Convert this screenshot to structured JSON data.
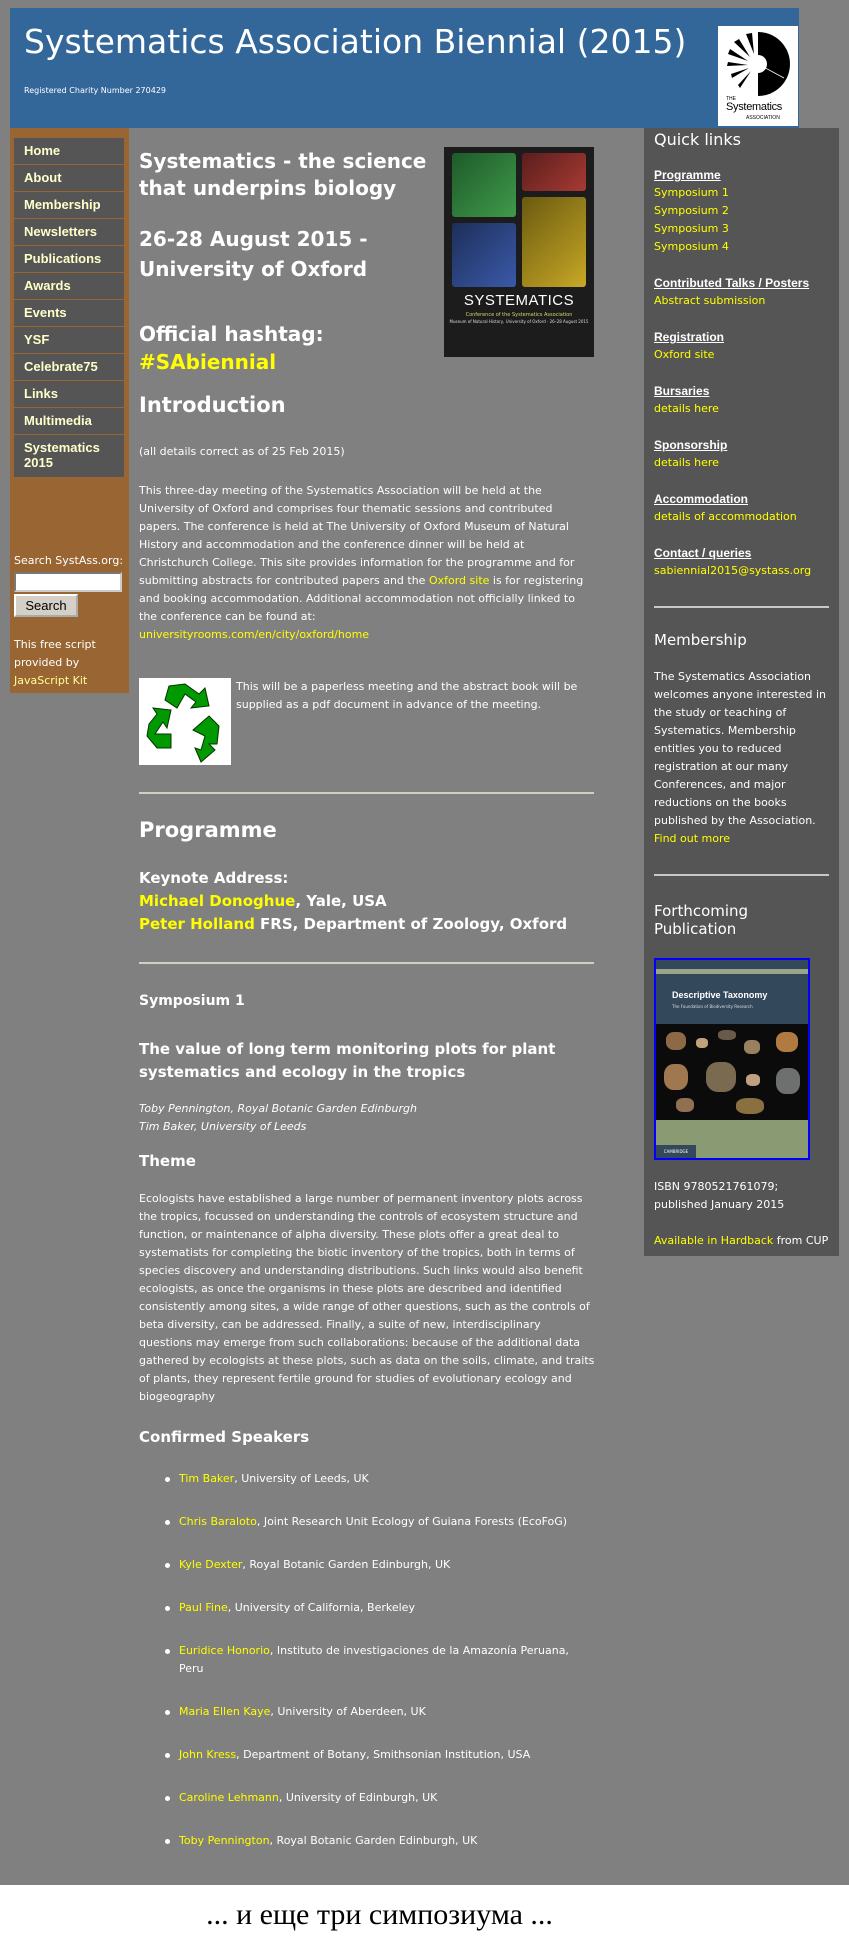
{
  "header": {
    "title": "Systematics Association Biennial (2015)",
    "charity": "Registered Charity Number 270429",
    "logo": {
      "icon": "systematics-association-logo",
      "line1": "THE",
      "line2": "Systematics",
      "line3": "ASSOCIATION"
    }
  },
  "colors": {
    "page_bg": "#808080",
    "header_bg": "#336699",
    "left_nav_bg": "#996633",
    "nav_item_bg": "#555555",
    "nav_text": "#ffffcc",
    "right_bar_bg": "#555555",
    "link": "#ffff00"
  },
  "nav": {
    "items": [
      {
        "label": "Home"
      },
      {
        "label": "About"
      },
      {
        "label": "Membership"
      },
      {
        "label": "Newsletters"
      },
      {
        "label": "Publications"
      },
      {
        "label": "Awards"
      },
      {
        "label": "Events"
      },
      {
        "label": "YSF"
      },
      {
        "label": "Celebrate75"
      },
      {
        "label": "Links"
      },
      {
        "label": "Multimedia"
      },
      {
        "label": "Systematics 2015"
      }
    ],
    "search_label": "Search SystAss.org:",
    "search_value": "",
    "search_button": "Search",
    "free_script_line1": "This free script",
    "free_script_line2": "provided by",
    "free_script_link": "JavaScript Kit"
  },
  "main": {
    "tagline": "Systematics - the science that underpins biology",
    "dates": "26-28 August 2015 - University of Oxford",
    "hashtag_label": "Official hashtag:",
    "hashtag": "#SAbiennial",
    "poster": {
      "title": "SYSTEMATICS",
      "subtitle": "Conference of the Systematics Association",
      "details": "Museum of Natural History, University of Oxford · 26–28 August 2015"
    },
    "intro_heading": "Introduction",
    "as_of": "(all details correct as of 25 Feb 2015)",
    "intro_text_1": "This three-day meeting of the Systematics Association will be held at the University of Oxford and comprises four thematic sessions and contributed papers. The conference is held at The University of Oxford Museum of Natural History and accommodation and the conference dinner will be held at Christchurch College. This site provides information for the programme and for submitting abstracts for contributed papers and the ",
    "intro_link_oxford": "Oxford site",
    "intro_text_2": " is for registering and booking accommodation. Additional accommodation not officially linked to the conference can be found at:",
    "intro_link_rooms": "universityrooms.com/en/city/oxford/home",
    "paperless": "This will be a paperless meeting and the abstract book will be supplied as a pdf document in advance of the meeting.",
    "programme_heading": "Programme",
    "keynote_label": "Keynote Address:",
    "keynotes": [
      {
        "name": "Michael Donoghue",
        "affiliation": ", Yale, USA"
      },
      {
        "name": "Peter Holland",
        "affiliation": " FRS, Department of Zoology, Oxford"
      }
    ],
    "symposium_label": "Symposium 1",
    "symposium_title": "The value of long term monitoring plots for plant systematics and ecology in the tropics",
    "organisers": [
      "Toby Pennington, Royal Botanic Garden Edinburgh",
      "Tim Baker, University of Leeds"
    ],
    "theme_heading": "Theme",
    "theme_text": "Ecologists have established a large number of permanent inventory plots across the tropics, focussed on understanding the controls of ecosystem structure and function, or maintenance of alpha diversity. These plots offer a great deal to systematists for completing the biotic inventory of the tropics, both in terms of species discovery and understanding distributions. Such links would also benefit ecologists, as once the organisms in these plots are described and identified consistently among sites, a wide range of other questions, such as the controls of beta diversity, can be addressed. Finally, a suite of new, interdisciplinary questions may emerge from such collaborations: because of the additional data gathered by ecologists at these plots, such as data on the soils, climate, and traits of plants, they represent fertile ground for studies of evolutionary ecology and biogeography",
    "speakers_heading": "Confirmed Speakers",
    "speakers": [
      {
        "name": "Tim Baker",
        "affiliation": ", University of Leeds, UK"
      },
      {
        "name": "Chris Baraloto",
        "affiliation": ", Joint Research Unit Ecology of Guiana Forests (EcoFoG)"
      },
      {
        "name": "Kyle Dexter",
        "affiliation": ", Royal Botanic Garden Edinburgh, UK"
      },
      {
        "name": "Paul Fine",
        "affiliation": ", University of California, Berkeley"
      },
      {
        "name": "Euridice Honorio",
        "affiliation": ", Instituto de investigaciones de la Amazonía Peruana, Peru"
      },
      {
        "name": "Maria Ellen Kaye",
        "affiliation": ", University of Aberdeen, UK"
      },
      {
        "name": "John Kress",
        "affiliation": ", Department of Botany, Smithsonian Institution, USA"
      },
      {
        "name": "Caroline Lehmann",
        "affiliation": ", University of Edinburgh, UK"
      },
      {
        "name": "Toby Pennington",
        "affiliation": ", Royal Botanic Garden Edinburgh, UK"
      }
    ]
  },
  "sidebar": {
    "quick_links_heading": "Quick links",
    "groups": [
      {
        "category": "Programme",
        "links": [
          "Symposium 1",
          "Symposium 2",
          "Symposium 3",
          "Symposium 4"
        ]
      },
      {
        "category": "Contributed Talks / Posters",
        "links": [
          "Abstract submission"
        ]
      },
      {
        "category": "Registration",
        "links": [
          "Oxford site"
        ]
      },
      {
        "category": "Bursaries",
        "links": [
          "details here"
        ]
      },
      {
        "category": "Sponsorship",
        "links": [
          "details here"
        ]
      },
      {
        "category": "Accommodation",
        "links": [
          "details of accommodation"
        ]
      },
      {
        "category": "Contact / queries",
        "links": [
          "sabiennial2015@systass.org"
        ]
      }
    ],
    "membership_heading": "Membership",
    "membership_text": "The Systematics Association welcomes anyone interested in the study or teaching of Systematics. Membership entitles you to reduced registration at our many Conferences, and major reductions on the books published by the Association.",
    "membership_link": "Find out more",
    "publication_heading": "Forthcoming Publication",
    "book": {
      "title": "Descriptive Taxonomy",
      "subtitle": "The Foundation of Biodiversity Research",
      "publisher": "CAMBRIDGE"
    },
    "isbn": "ISBN 9780521761079; published January 2015",
    "available_link": "Available in Hardback",
    "available_suffix": " from CUP"
  },
  "caption": "... и  еще  три  симпозиума ..."
}
